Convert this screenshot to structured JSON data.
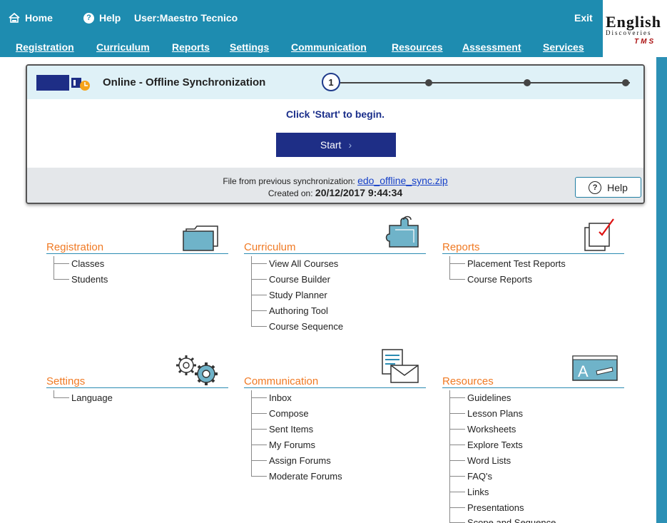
{
  "topbar": {
    "home": "Home",
    "help": "Help",
    "user": "User:Maestro Tecnico",
    "exit": "Exit"
  },
  "nav": [
    "Registration",
    "Curriculum",
    "Reports",
    "Settings",
    "Communication",
    "Resources",
    "Assessment",
    "Services"
  ],
  "logo": {
    "main": "English",
    "sub": "Discoveries",
    "tms": "TMS"
  },
  "sync": {
    "title": "Online - Offline Synchronization",
    "current_step": "1",
    "message": "Click 'Start' to begin.",
    "start_label": "Start",
    "prev_file_label": "File from previous synchronization:",
    "prev_file_name": "edo_offline_sync.zip",
    "created_label": "Created on:",
    "created_value": "20/12/2017 9:44:34",
    "help_label": "Help"
  },
  "sections": {
    "registration": {
      "title": "Registration",
      "items": [
        "Classes",
        "Students"
      ]
    },
    "curriculum": {
      "title": "Curriculum",
      "items": [
        "View All Courses",
        "Course Builder",
        "Study Planner",
        "Authoring Tool",
        "Course Sequence"
      ]
    },
    "reports": {
      "title": "Reports",
      "items": [
        "Placement Test Reports",
        "Course Reports"
      ]
    },
    "settings": {
      "title": "Settings",
      "items": [
        "Language"
      ]
    },
    "communication": {
      "title": "Communication",
      "items": [
        "Inbox",
        "Compose",
        "Sent Items",
        "My Forums",
        "Assign Forums",
        "Moderate Forums"
      ]
    },
    "resources": {
      "title": "Resources",
      "items": [
        "Guidelines",
        "Lesson Plans",
        "Worksheets",
        "Explore Texts",
        "Word Lists",
        "FAQ's",
        "Links",
        "Presentations",
        "Scope and Sequence"
      ]
    }
  },
  "colors": {
    "topbar": "#1e8cb0",
    "accent_orange": "#f07a24",
    "button_navy": "#1e2e86"
  }
}
